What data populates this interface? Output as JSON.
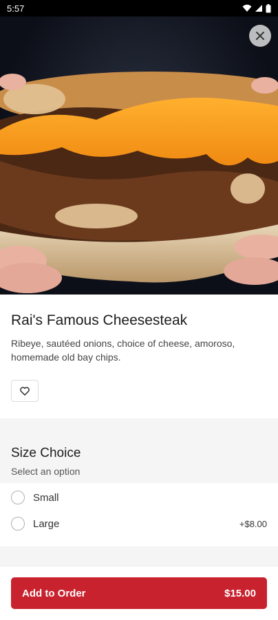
{
  "status_bar": {
    "time": "5:57"
  },
  "item": {
    "name": "Rai's Famous Cheesesteak",
    "description": "Ribeye, sautéed onions, choice of cheese, amoroso, homemade old bay chips."
  },
  "size_choice": {
    "title": "Size Choice",
    "subtitle": "Select an option",
    "options": [
      {
        "label": "Small",
        "price": ""
      },
      {
        "label": "Large",
        "price": "+$8.00"
      }
    ]
  },
  "order_button": {
    "label": "Add to Order",
    "price": "$15.00"
  },
  "colors": {
    "accent": "#c8222e"
  },
  "icons": {
    "close": "close-icon",
    "favorite": "heart-icon"
  }
}
